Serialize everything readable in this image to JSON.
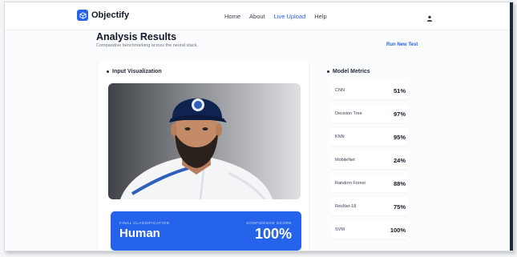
{
  "app": {
    "name": "Objectify"
  },
  "nav": {
    "links": [
      {
        "label": "Home"
      },
      {
        "label": "About"
      },
      {
        "label": "Live Upload"
      },
      {
        "label": "Help"
      }
    ],
    "active": "Live Upload"
  },
  "header": {
    "title": "Analysis Results",
    "subtitle": "Comparative benchmarking across the neural stack.",
    "action_label": "Run New Test"
  },
  "visualization": {
    "heading": "Input Visualization"
  },
  "classification": {
    "label": "FINAL CLASSIFICATION",
    "value": "Human",
    "confidence_label": "CONFIDENCE SCORE",
    "confidence_value": "100%"
  },
  "metrics": {
    "heading": "Model Metrics",
    "items": [
      {
        "model": "CNN",
        "score": "51%"
      },
      {
        "model": "Decision Tree",
        "score": "97%"
      },
      {
        "model": "KNN",
        "score": "95%"
      },
      {
        "model": "MobileNet",
        "score": "24%"
      },
      {
        "model": "Random Forest",
        "score": "88%"
      },
      {
        "model": "ResNet-18",
        "score": "75%"
      },
      {
        "model": "SVM",
        "score": "100%"
      }
    ]
  },
  "icons": {
    "logo": "cube-icon",
    "user": "user-icon"
  },
  "colors": {
    "accent": "#2563eb",
    "background": "#fbfcfe",
    "text": "#111827"
  }
}
